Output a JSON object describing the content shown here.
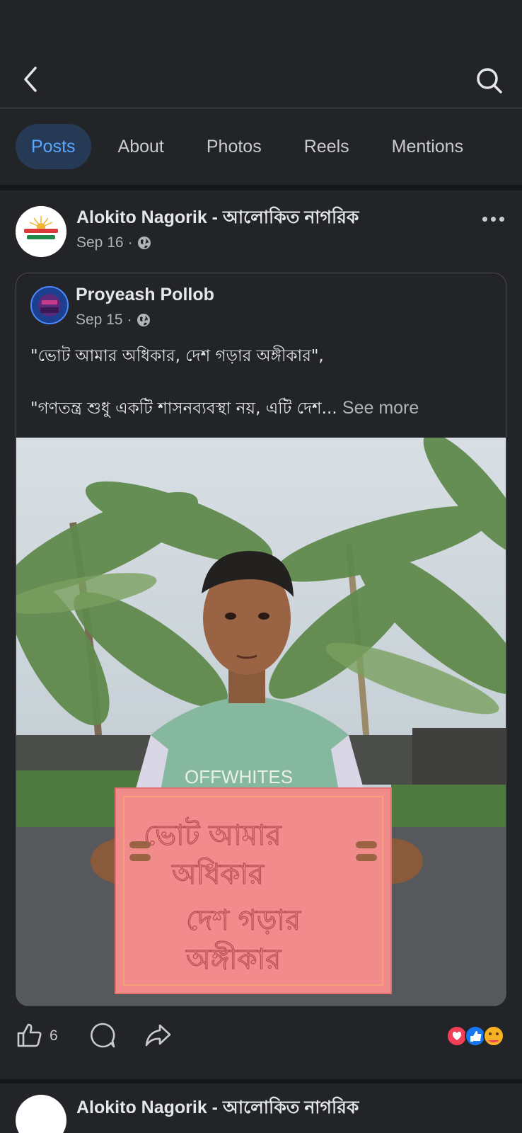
{
  "tabs": [
    {
      "label": "Posts",
      "active": true
    },
    {
      "label": "About"
    },
    {
      "label": "Photos"
    },
    {
      "label": "Reels"
    },
    {
      "label": "Mentions"
    }
  ],
  "post": {
    "page_name": "Alokito Nagorik - আলোকিত নাগরিক",
    "date": "Sep 16",
    "separator": "·",
    "shared": {
      "author": "Proyeash Pollob",
      "date": "Sep 15",
      "separator": "·",
      "text_line1": "\"ভোট আমার অধিকার, দেশ গড়ার অঙ্গীকার\",",
      "text_line2": "\"গণতন্ত্র শুধু একটি শাসনব্যবস্থা নয়, এটি দেশ...",
      "see_more": "See more",
      "photo": {
        "shirt_text": "OFFWHITES",
        "sign_text": [
          "ভোট আমার",
          "অধিকার",
          "দেশ গড়ার",
          "অঙ্গীকার"
        ]
      }
    },
    "like_count": "6"
  },
  "next_post": {
    "page_name": "Alokito Nagorik - আলোকিত নাগরিক"
  },
  "icons": {
    "back": "chevron-left-icon",
    "search": "search-icon",
    "more": "more-horizontal-icon",
    "globe": "globe-icon",
    "like": "thumbs-up-icon",
    "comment": "comment-icon",
    "share": "share-icon"
  },
  "colors": {
    "background": "#232427",
    "accent": "#5aa7ff",
    "active_tab_bg": "#263a55",
    "love": "#f33e58",
    "like": "#1877f2",
    "care": "#f7b125"
  }
}
